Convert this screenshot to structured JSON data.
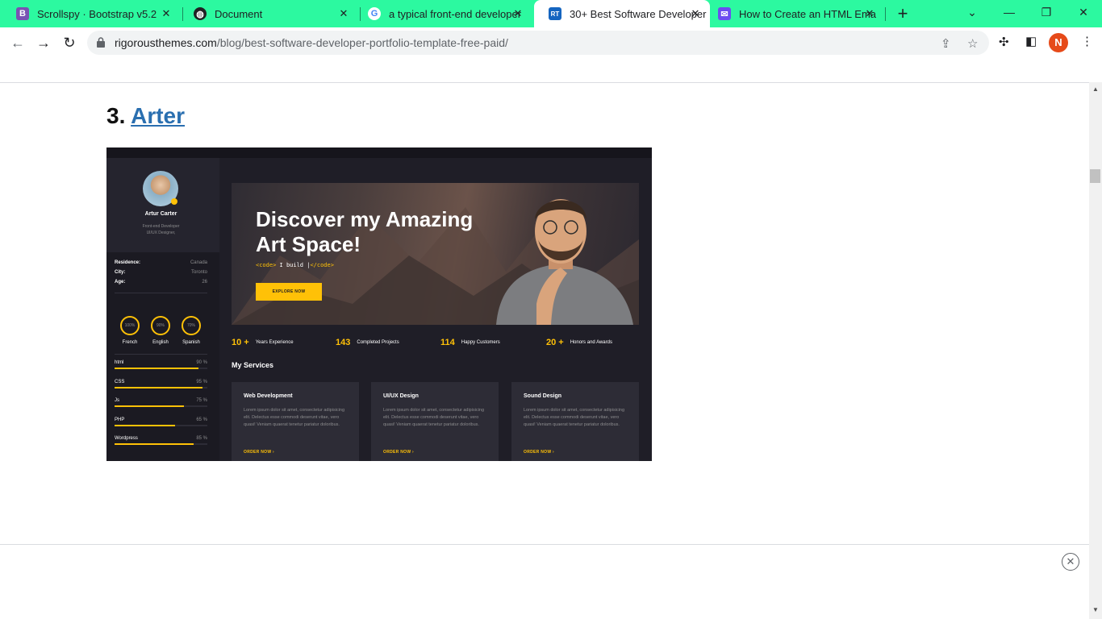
{
  "browser": {
    "tabs": [
      {
        "title": "Scrollspy · Bootstrap v5.2",
        "icon": "bootstrap-icon",
        "active": false
      },
      {
        "title": "Document",
        "icon": "globe-icon",
        "active": false
      },
      {
        "title": "a typical front-end developer",
        "icon": "google-icon",
        "active": false
      },
      {
        "title": "30+ Best Software Developer",
        "icon": "rt-icon",
        "active": true
      },
      {
        "title": "How to Create an HTML Ema",
        "icon": "mail-icon",
        "active": false
      }
    ],
    "url_domain": "rigorousthemes.com",
    "url_path": "/blog/best-software-developer-portfolio-template-free-paid/",
    "profile_initial": "N",
    "accent": "#2cf9a0"
  },
  "article": {
    "heading_number": "3.",
    "heading_link": "Arter"
  },
  "preview": {
    "name": "Artur Carter",
    "role_line1": "Front-end Developer",
    "role_line2": "UI/UX Designer,",
    "info": [
      {
        "label": "Residence:",
        "value": "Canada"
      },
      {
        "label": "City:",
        "value": "Toronto"
      },
      {
        "label": "Age:",
        "value": "26"
      }
    ],
    "languages": [
      {
        "name": "French",
        "pct": "100%"
      },
      {
        "name": "English",
        "pct": "90%"
      },
      {
        "name": "Spanish",
        "pct": "70%"
      }
    ],
    "skills": [
      {
        "name": "html",
        "pct_label": "90 %",
        "level": 0.9
      },
      {
        "name": "CSS",
        "pct_label": "95 %",
        "level": 0.95
      },
      {
        "name": "Js",
        "pct_label": "75 %",
        "level": 0.75
      },
      {
        "name": "PHP",
        "pct_label": "65 %",
        "level": 0.65
      },
      {
        "name": "Wordpress",
        "pct_label": "85 %",
        "level": 0.85
      }
    ],
    "hero_title_line1": "Discover my Amazing",
    "hero_title_line2": "Art Space!",
    "code_open": "<code>",
    "code_text": " I build |",
    "code_close": "</code>",
    "explore_label": "EXPLORE NOW",
    "stats": [
      {
        "number": "10 +",
        "label": "Years Experience"
      },
      {
        "number": "143",
        "label": "Completed Projects"
      },
      {
        "number": "114",
        "label": "Happy Customers"
      },
      {
        "number": "20 +",
        "label": "Honors and Awards"
      }
    ],
    "services_heading": "My Services",
    "services": [
      {
        "title": "Web Development",
        "desc": "Lorem ipsum dolor sit amet, consectetur adipisicing elit. Delectus esse commodi deserunt vitae, vero quasi! Veniam quaerat tenetur pariatur doloribus.",
        "order": "ORDER NOW ›"
      },
      {
        "title": "UI/UX Design",
        "desc": "Lorem ipsum dolor sit amet, consectetur adipisicing elit. Delectus esse commodi deserunt vitae, vero quasi! Veniam quaerat tenetur pariatur doloribus.",
        "order": "ORDER NOW ›"
      },
      {
        "title": "Sound Design",
        "desc": "Lorem ipsum dolor sit amet, consectetur adipisicing elit. Delectus esse commodi deserunt vitae, vero quasi! Veniam quaerat tenetur pariatur doloribus.",
        "order": "ORDER NOW ›"
      }
    ],
    "accent": "#ffc107"
  }
}
